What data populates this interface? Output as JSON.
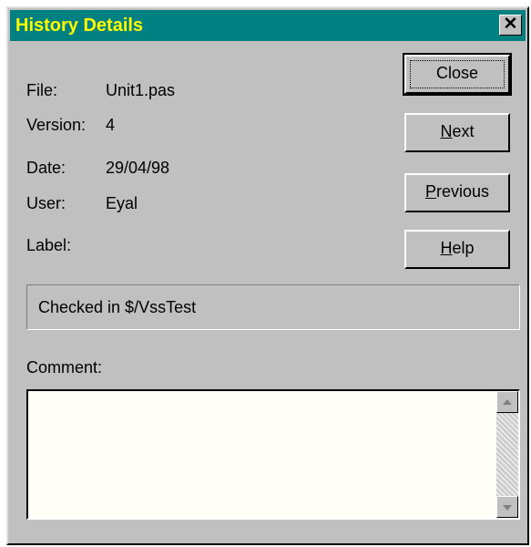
{
  "window": {
    "title": "History Details",
    "close_glyph": "✕"
  },
  "details": [
    {
      "label": "File:",
      "value": "Unit1.pas"
    },
    {
      "label": "Version:",
      "value": "4"
    },
    {
      "label": "Date:",
      "value": "29/04/98"
    },
    {
      "label": "User:",
      "value": "Eyal"
    },
    {
      "label": "Label:",
      "value": ""
    }
  ],
  "buttons": {
    "close": "Close",
    "next": {
      "mnemonic": "N",
      "rest": "ext"
    },
    "previous": {
      "mnemonic": "P",
      "rest": "revious"
    },
    "help": {
      "mnemonic": "H",
      "rest": "elp"
    }
  },
  "action_text": "Checked in $/VssTest",
  "comment": {
    "label": "Comment:",
    "value": ""
  },
  "colors": {
    "title_bg": "#008080",
    "title_fg": "#ffff00",
    "face": "#c0c0c0"
  }
}
